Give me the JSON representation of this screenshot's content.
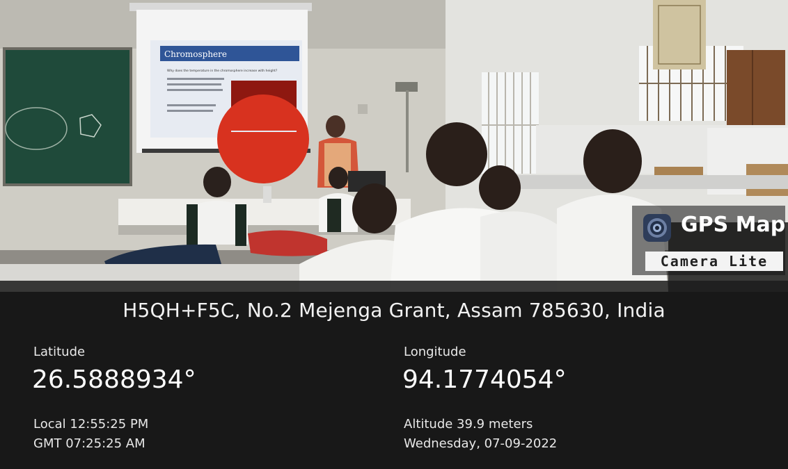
{
  "overlay": {
    "address": "H5QH+F5C, No.2 Mejenga Grant, Assam 785630, India",
    "latitude_label": "Latitude",
    "latitude_value": "26.5888934°",
    "longitude_label": "Longitude",
    "longitude_value": "94.1774054°",
    "local_time": "Local 12:55:25 PM",
    "gmt_time": "GMT 07:25:25 AM",
    "altitude": "Altitude 39.9 meters",
    "date": "Wednesday, 07-09-2022"
  },
  "badge": {
    "title": "GPS Map",
    "subtitle": "Camera Lite",
    "icon": "camera-lens-icon"
  },
  "slide": {
    "title": "Chromosphere",
    "question": "Why does the temperature in the chromosphere increase with height?"
  },
  "colors": {
    "overlay_bg": "#1c1c1c",
    "chalkboard": "#1f4a3a",
    "wall": "#d8d6cf",
    "slide_header": "#2f5597",
    "sun_red": "#d8321f"
  }
}
